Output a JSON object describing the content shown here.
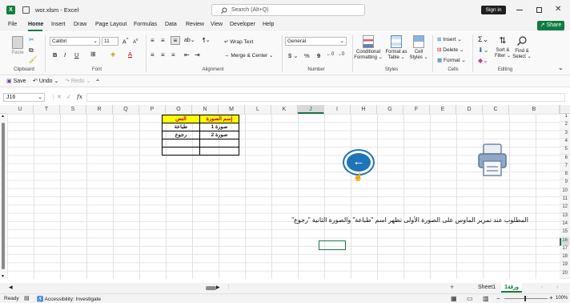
{
  "window": {
    "file_name": "wor.xlsm",
    "app": "Excel",
    "title_sep": " - ",
    "search_placeholder": "Search (Alt+Q)",
    "signin": "Sign in",
    "share": "Share"
  },
  "menu": [
    "File",
    "Home",
    "Insert",
    "Draw",
    "Page Layout",
    "Formulas",
    "Data",
    "Review",
    "View",
    "Developer",
    "Help"
  ],
  "active_menu": "Home",
  "ribbon": {
    "paste": "Paste",
    "clipboard": "Clipboard",
    "font_name": "Calibri",
    "font_size": "11",
    "font": "Font",
    "bold": "B",
    "italic": "I",
    "underline": "U",
    "wrap_text": "Wrap Text",
    "merge_center": "Merge & Center",
    "alignment": "Alignment",
    "number_format": "General",
    "currency": "$",
    "percent": "%",
    "comma": "9",
    "number": "Number",
    "cond_fmt": "Conditional",
    "cond_fmt2": "Formatting",
    "format_table": "Format as",
    "format_table2": "Table",
    "cell_styles": "Cell",
    "cell_styles2": "Styles",
    "styles": "Styles",
    "insert": "Insert",
    "delete": "Delete",
    "format": "Format",
    "cells": "Cells",
    "sort_filter": "Sort &",
    "sort_filter2": "Filter",
    "find_select": "Find &",
    "find_select2": "Select",
    "editing": "Editing"
  },
  "qat": {
    "save": "Save",
    "undo": "Undo",
    "redo": "Redo"
  },
  "formula": {
    "name_box": "J16",
    "fx": "fx",
    "value": ""
  },
  "columns": [
    "U",
    "T",
    "S",
    "R",
    "Q",
    "P",
    "O",
    "N",
    "M",
    "L",
    "K",
    "J",
    "I",
    "H",
    "G",
    "F",
    "E",
    "D",
    "C",
    "B"
  ],
  "rows": [
    "1",
    "2",
    "3",
    "4",
    "5",
    "6",
    "7",
    "8",
    "9",
    "10",
    "11",
    "12",
    "13",
    "14",
    "15",
    "16",
    "17",
    "18",
    "19",
    "20"
  ],
  "table": {
    "header_name": "إسم الصورة",
    "header_text": "النص",
    "rows": [
      {
        "name": "صورة 1",
        "text": "طباعة"
      },
      {
        "name": "صورة 2",
        "text": "رجوع"
      }
    ]
  },
  "instruction": "المطلوب عند تمرير الماوس على الصورة الأولى تظهر اسم \"طباعة\" والصورة الثانية \"رجوع\"",
  "sheets": [
    "Sheet1",
    "ورقة1"
  ],
  "active_sheet": "ورقة1",
  "status": {
    "ready": "Ready",
    "accessibility": "Accessibility: Investigate",
    "zoom": "100%"
  },
  "colors": {
    "accent_green": "#107c41",
    "header_yellow": "#ffff00",
    "back_button": "#1e74b8",
    "selection": "#217346"
  },
  "icons": [
    "excel-icon",
    "save-icon",
    "search-icon",
    "back-arrow-icon",
    "printer-icon"
  ]
}
